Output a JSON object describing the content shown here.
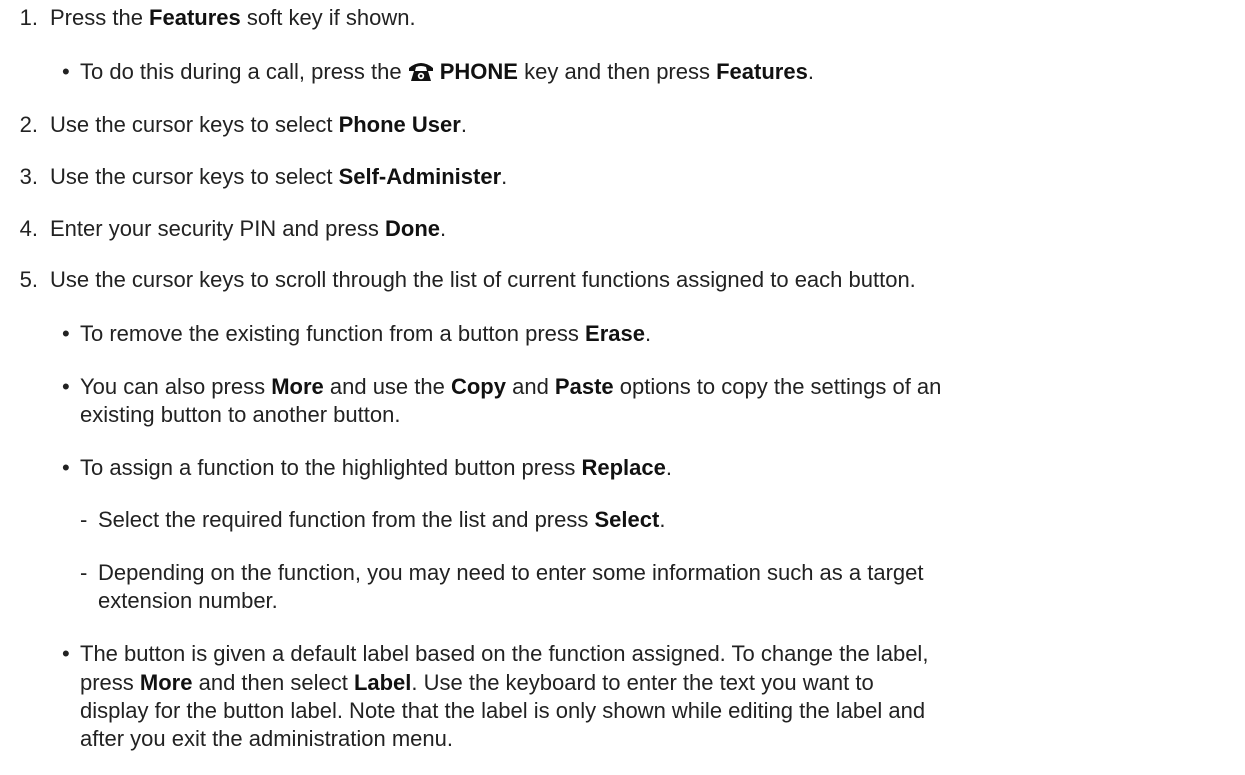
{
  "steps": [
    {
      "number": "1.",
      "pre": "Press the ",
      "b1": "Features",
      "post": " soft key if shown."
    },
    {
      "number": "2.",
      "pre": "Use the cursor keys to select ",
      "b1": "Phone User",
      "post": "."
    },
    {
      "number": "3.",
      "pre": "Use the cursor keys to select ",
      "b1": "Self-Administer",
      "post": "."
    },
    {
      "number": "4.",
      "pre": "Enter your security PIN and press ",
      "b1": "Done",
      "post": "."
    },
    {
      "number": "5.",
      "text": "Use the cursor keys to scroll through the list of current functions assigned to each button."
    }
  ],
  "step1_sub": {
    "bullet": "•",
    "pre": "To do this during a call, press the ",
    "key": "PHONE",
    "mid": " key and then press ",
    "b2": "Features",
    "post": "."
  },
  "step5_subs": {
    "erase": {
      "bullet": "•",
      "pre": "To remove the existing function from a button press ",
      "b1": "Erase",
      "post": "."
    },
    "copy": {
      "bullet": "•",
      "pre": "You can also press ",
      "b1": "More",
      "mid1": " and use the ",
      "b2": "Copy",
      "mid2": " and ",
      "b3": "Paste",
      "post": " options to copy the settings of an",
      "line2": "existing button to another button."
    },
    "replace": {
      "bullet": "•",
      "pre": "To assign a function to the highlighted button press ",
      "b1": "Replace",
      "post": "."
    },
    "replace_subs": {
      "select": {
        "dash": "-",
        "pre": "Select the required function from the list and press ",
        "b1": "Select",
        "post": "."
      },
      "depending": {
        "dash": "-",
        "line1": "Depending on the function, you may need to enter some information such as a target",
        "line2": "extension number."
      }
    },
    "label": {
      "bullet": "•",
      "line1": "The button is given a default label based on the function assigned. To change the label,",
      "l2_pre": "press ",
      "l2_b1": "More",
      "l2_mid": " and then select ",
      "l2_b2": "Label",
      "l2_post": ". Use the keyboard to enter the text you want to",
      "line3": "display for the button label. Note that the label is only shown while editing the label and",
      "line4": "after you exit the administration menu."
    }
  },
  "icons": {
    "phone_key": "phone-icon"
  }
}
